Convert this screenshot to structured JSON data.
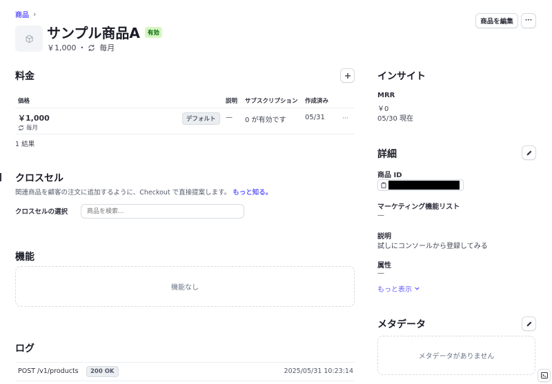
{
  "breadcrumb": {
    "label": "商品",
    "separator": "›"
  },
  "product": {
    "name": "サンプル商品A",
    "status": "有効",
    "price": "￥1,000",
    "dot": "•",
    "interval": "毎月"
  },
  "header_actions": {
    "edit_label": "商品を編集",
    "more_label": "···"
  },
  "pricing": {
    "title": "料金",
    "columns": {
      "price": "価格",
      "description": "説明",
      "subscriptions": "サブスクリプション",
      "created": "作成済み"
    },
    "rows": [
      {
        "amount": "￥1,000",
        "interval": "毎月",
        "badge": "デフォルト",
        "description": "—",
        "subscriptions": "0 が有効です",
        "created": "05/31",
        "more": "···"
      }
    ],
    "result_count": "1 結果"
  },
  "crosssell": {
    "title": "クロスセル",
    "description": "関連商品を顧客の注文に追加するように、Checkout で直接提案します。",
    "learn_more": "もっと知る。",
    "select_label": "クロスセルの選択",
    "search_placeholder": "商品を検索..."
  },
  "features": {
    "title": "機能",
    "empty": "機能なし"
  },
  "logs": {
    "title": "ログ",
    "entries": [
      {
        "request": "POST /v1/products",
        "status": "200 OK",
        "timestamp": "2025/05/31 10:23:14"
      }
    ]
  },
  "insights": {
    "title": "インサイト",
    "metric_label": "MRR",
    "metric_value": "￥0",
    "as_of": "05/30 現在"
  },
  "details": {
    "title": "詳細",
    "product_id_label": "商品 ID",
    "marketing_label": "マーケティング機能リスト",
    "marketing_value": "—",
    "description_label": "説明",
    "description_value": "試しにコンソールから登録してみる",
    "attributes_label": "属性",
    "attributes_value": "—",
    "show_more": "もっと表示"
  },
  "metadata": {
    "title": "メタデータ",
    "empty": "メタデータがありません"
  },
  "colors": {
    "accent": "#635bff",
    "active_bg": "#d7f7c2",
    "active_text": "#05690d",
    "text": "#30313d",
    "border": "#d5dbe1"
  }
}
